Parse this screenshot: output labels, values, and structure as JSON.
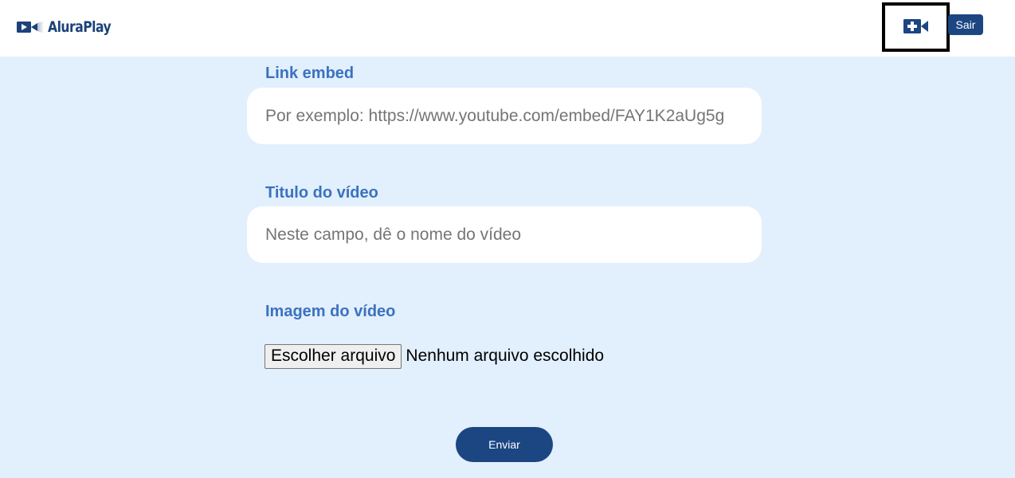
{
  "header": {
    "logo_text": "AluraPlay",
    "add_video_icon": "video-plus-icon",
    "logout_label": "Sair"
  },
  "form": {
    "link": {
      "label": "Link embed",
      "placeholder": "Por exemplo: https://www.youtube.com/embed/FAY1K2aUg5g",
      "value": ""
    },
    "title": {
      "label": "Titulo do vídeo",
      "placeholder": "Neste campo, dê o nome do vídeo",
      "value": ""
    },
    "image": {
      "label": "Imagem do vídeo",
      "button_label": "Escolher arquivo",
      "status": "Nenhum arquivo escolhido"
    },
    "submit_label": "Enviar"
  },
  "colors": {
    "brand": "#1b4682",
    "label": "#3a72c0",
    "background": "#e2effd",
    "header_bg": "#ffffff"
  }
}
